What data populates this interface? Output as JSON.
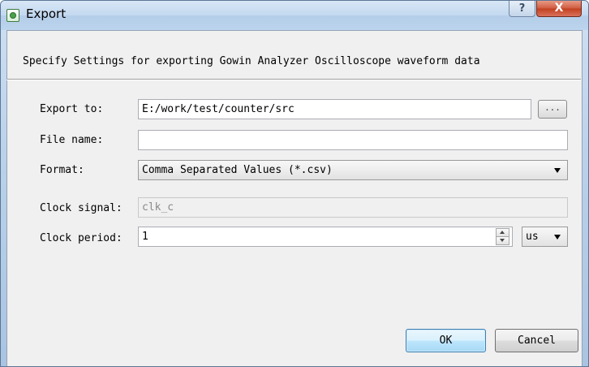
{
  "window": {
    "title": "Export",
    "help_label": "?",
    "close_label": "X"
  },
  "header": {
    "text": "Specify Settings for exporting Gowin Analyzer Oscilloscope waveform data"
  },
  "form": {
    "export_to": {
      "label": "Export to:",
      "value": "E:/work/test/counter/src",
      "browse_label": "..."
    },
    "file_name": {
      "label": "File name:",
      "value": ""
    },
    "format": {
      "label": "Format:",
      "value": "Comma Separated Values (*.csv)"
    },
    "clock_signal": {
      "label": "Clock signal:",
      "value": "clk_c"
    },
    "clock_period": {
      "label": "Clock period:",
      "value": "1",
      "unit": "us"
    }
  },
  "buttons": {
    "ok": "OK",
    "cancel": "Cancel"
  }
}
